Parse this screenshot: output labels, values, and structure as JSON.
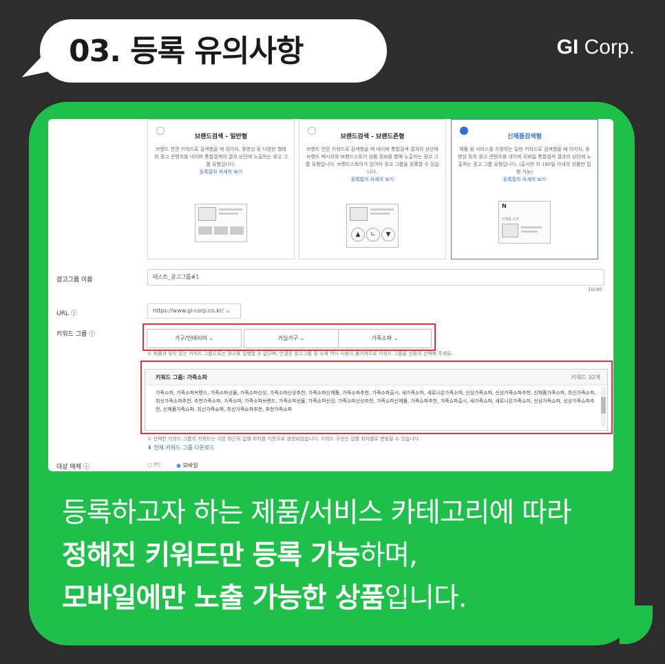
{
  "header": {
    "title": "03. 등록 유의사항",
    "logo_bold": "GI",
    "logo_rest": " Corp."
  },
  "cards": [
    {
      "title": "브랜드검색 - 일반형",
      "desc": "브랜드 연관 키워드로 검색했을 때 이미지, 동영상 등 다양한 형태의 광고 콘텐츠를 네이버 통합검색의 결과 상단에 노출하는 광고 그룹 유형입니다.",
      "link": "등록절차 자세히 보기",
      "selected": false
    },
    {
      "title": "브랜드검색 - 브랜드존형",
      "desc": "브랜드 연관 키워드로 검색했을 때 네이버 통합검색 결과의 상단에 브랜드 메시지와 브랜드스토어 상품 정보를 함께 노출하는 광고 그룹 유형입니다. 브랜드스토어가 있어야 광고 그룹을 등록할 수 있습니다.",
      "link": "등록절차 자세히 보기",
      "selected": false
    },
    {
      "title": "신제품검색형",
      "desc": "제품 및 서비스를 지칭하는 일반 키워드로 검색했을 때 이미지, 동영상 등의 광고 콘텐츠를 네이버 모바일 통합검색 결과의 상단에 노출하는 광고 그룹 유형입니다. (출시한 지 180일 이내의 상품만 집행 가능)",
      "link": "등록절차 자세히 보기",
      "selected": true
    }
  ],
  "card3_ill": {
    "n": "N",
    "sub": "신제품 소개"
  },
  "form": {
    "adgroup_label": "광고그룹 이름",
    "adgroup_value": "테스트_광고그룹#1",
    "adgroup_count": "10/30",
    "url_label": "URL",
    "url_value": "https://www.gi-corp.co.kr/",
    "keyword_label": "키워드 그룹",
    "keyword_buttons": [
      "가구/인테리어",
      "거실가구",
      "가죽소파"
    ],
    "keyword_note": "① 제품과 맞지 않는 키워드 그룹으로는 광고를 집행할 수 없으며, 연결된 광고그룹 및 소재 역시 사용이 불가하므로 키워드 그룹을 신중히 선택해 주세요.",
    "kw_group_title": "키워드 그룹: 가죽소파",
    "kw_group_count": "키워드 32개",
    "kw_list": "가죽소파, 가죽소파브랜드, 가죽소파선물, 가죽소파신상, 가죽소파신상추천, 가죽소파신제품, 가죽소파추천, 가죽소파출시, 새가죽소파, 새로나온가죽소파, 신상가죽소파, 신상가죽소파추천, 신제품가죽소파, 최신가죽소파, 최신가죽소파추천, 추천가죽소파, 가죽소파, 가죽소파브랜드, 가죽소파선물, 가죽소파신상, 가죽소파신상추천, 가죽쇼파신제품, 가죽쇼파추천, 가죽쇼파출시, 새가죽쇼파, 새로나온가죽쇼파, 신상가죽쇼파, 신상가죽쇼파추천, 신제품가죽쇼파, 최신가죽쇼파, 최신가죽쇼파추천, 추천가죽쇼파",
    "kw_note": "① 선택한 키워드 그룹의 키워드는 가장 최근의 집행 회차를 기준으로 생성되었습니다. 키워드 구성은 집행 회차별로 변동될 수 있습니다.",
    "download_label": "전체 키워드 그룹 다운로드",
    "media_label": "대상 매체",
    "media_pc": "PC",
    "media_mobile": "모바일"
  },
  "caption": {
    "line1": "등록하고자 하는 제품/서비스 카테고리에 따라",
    "line2_bold": "정해진 키워드만 등록 가능",
    "line2_rest": "하며,",
    "line3_bold": "모바일에만 노출 가능한 상품",
    "line3_rest": "입니다."
  },
  "colors": {
    "background": "#2d2d2d",
    "green": "#1fc04a",
    "accent_blue": "#2f6fd8",
    "highlight_red": "#e0303a"
  }
}
